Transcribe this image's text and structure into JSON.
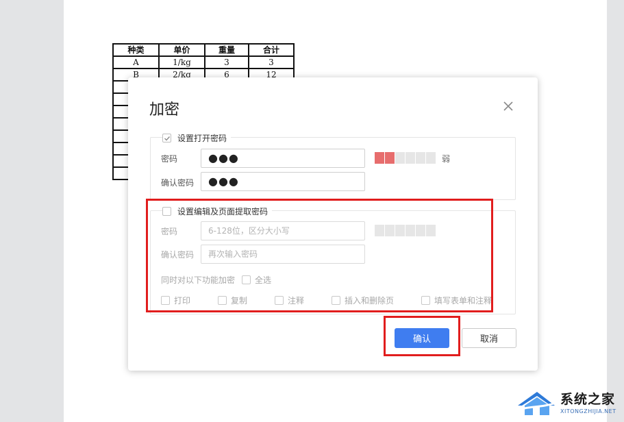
{
  "document": {
    "table": {
      "headers": [
        "种类",
        "单价",
        "重量",
        "合计"
      ],
      "rows": [
        [
          "A",
          "1/kg",
          "3",
          "3"
        ],
        [
          "B",
          "2/kg",
          "6",
          "12"
        ]
      ]
    }
  },
  "dialog": {
    "title": "加密",
    "open_password": {
      "legend": "设置打开密码",
      "checked": true,
      "password_label": "密码",
      "password_value": "●●●",
      "confirm_label": "确认密码",
      "confirm_value": "●●●",
      "strength_label": "弱"
    },
    "edit_password": {
      "legend": "设置编辑及页面提取密码",
      "checked": false,
      "password_label": "密码",
      "password_placeholder": "6-128位，区分大小写",
      "confirm_label": "确认密码",
      "confirm_placeholder": "再次输入密码",
      "features_label": "同时对以下功能加密",
      "select_all": "全选",
      "options": [
        "打印",
        "复制",
        "注释",
        "插入和删除页",
        "填写表单和注释"
      ]
    },
    "confirm_button": "确认",
    "cancel_button": "取消"
  },
  "watermark": {
    "name": "系统之家",
    "url": "XITONGZHIJIA.NET"
  },
  "colors": {
    "primary": "#3f7df0",
    "strength_weak": "#e76d6d",
    "highlight": "#e11d1d"
  }
}
